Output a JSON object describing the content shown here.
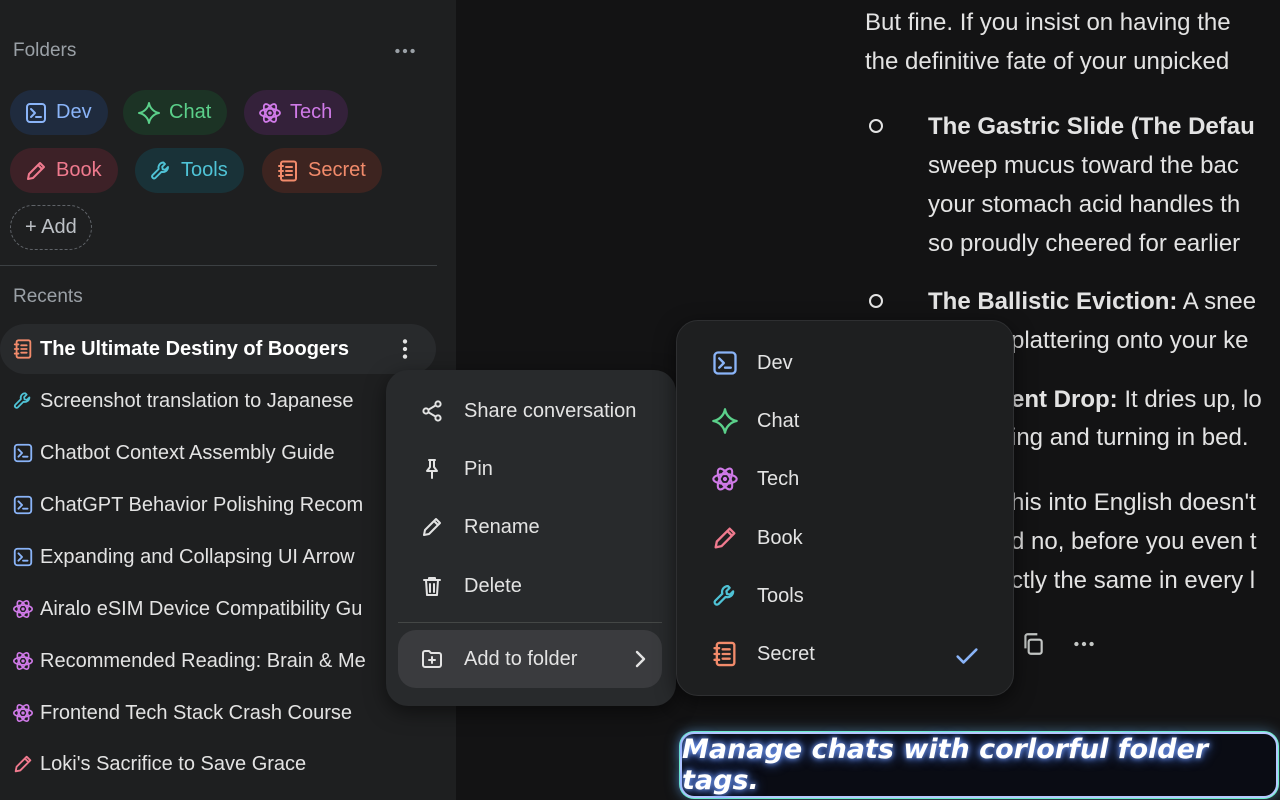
{
  "sidebar": {
    "folders_title": "Folders",
    "folders": [
      {
        "label": "Dev",
        "icon": "terminal-icon",
        "color": "#8ab4f8",
        "bg": "#1f2b3e"
      },
      {
        "label": "Chat",
        "icon": "sparkle-icon",
        "color": "#5bd08a",
        "bg": "#1c3325"
      },
      {
        "label": "Tech",
        "icon": "atom-icon",
        "color": "#d07ae8",
        "bg": "#34213a"
      },
      {
        "label": "Book",
        "icon": "pencil-icon",
        "color": "#f07a8e",
        "bg": "#3d2127"
      },
      {
        "label": "Tools",
        "icon": "wrench-icon",
        "color": "#4fc3d6",
        "bg": "#193238"
      },
      {
        "label": "Secret",
        "icon": "notebook-icon",
        "color": "#f28b6b",
        "bg": "#3d2420"
      }
    ],
    "add_label": "+ Add",
    "recents_title": "Recents",
    "recents": [
      {
        "title": "The Ultimate Destiny of Boogers",
        "icon": "notebook-icon",
        "color": "#f28b6b",
        "active": true
      },
      {
        "title": "Screenshot translation to Japanese",
        "icon": "wrench-icon",
        "color": "#4fc3d6"
      },
      {
        "title": "Chatbot Context Assembly Guide",
        "icon": "terminal-icon",
        "color": "#8ab4f8"
      },
      {
        "title": "ChatGPT Behavior Polishing Recom",
        "icon": "terminal-icon",
        "color": "#8ab4f8"
      },
      {
        "title": "Expanding and Collapsing UI Arrow",
        "icon": "terminal-icon",
        "color": "#8ab4f8"
      },
      {
        "title": "Airalo eSIM Device Compatibility Gu",
        "icon": "atom-icon",
        "color": "#d07ae8"
      },
      {
        "title": "Recommended Reading: Brain & Me",
        "icon": "atom-icon",
        "color": "#d07ae8"
      },
      {
        "title": "Frontend Tech Stack Crash Course",
        "icon": "atom-icon",
        "color": "#d07ae8"
      },
      {
        "title": "Loki's Sacrifice to Save Grace",
        "icon": "pencil-icon",
        "color": "#f07a8e"
      }
    ]
  },
  "main": {
    "line1": "But fine. If you insist on having the",
    "line2": "the definitive fate of your unpicked",
    "b1_bold": "The Gastric Slide (The Defau",
    "b1_l2": "sweep mucus toward the bac",
    "b1_l3": "your stomach acid handles th",
    "b1_l4": "so proudly cheered for earlier",
    "b2_bold": "The Ballistic Eviction:",
    "b2_rest": " A snee",
    "b2_l2": "plattering onto your ke",
    "b3_bold": "ent Drop:",
    "b3_rest": " It dries up, lo",
    "b3_l2": "ing and turning in bed.",
    "p_l1": "his into English doesn't",
    "p_l2": "d no, before you even t",
    "p_l3": "ctly the same in every l"
  },
  "context_menu": {
    "items": [
      {
        "label": "Share conversation",
        "icon": "share-icon"
      },
      {
        "label": "Pin",
        "icon": "pin-icon"
      },
      {
        "label": "Rename",
        "icon": "pencil-icon"
      },
      {
        "label": "Delete",
        "icon": "trash-icon"
      }
    ],
    "add_to_folder": "Add to folder"
  },
  "folder_submenu": {
    "items": [
      {
        "label": "Dev",
        "icon": "terminal-icon",
        "color": "#8ab4f8"
      },
      {
        "label": "Chat",
        "icon": "sparkle-icon",
        "color": "#5bd08a"
      },
      {
        "label": "Tech",
        "icon": "atom-icon",
        "color": "#d07ae8"
      },
      {
        "label": "Book",
        "icon": "pencil-icon",
        "color": "#f07a8e"
      },
      {
        "label": "Tools",
        "icon": "wrench-icon",
        "color": "#4fc3d6"
      },
      {
        "label": "Secret",
        "icon": "notebook-icon",
        "color": "#f28b6b",
        "checked": true
      }
    ]
  },
  "promo": "Manage chats with corlorful folder tags."
}
